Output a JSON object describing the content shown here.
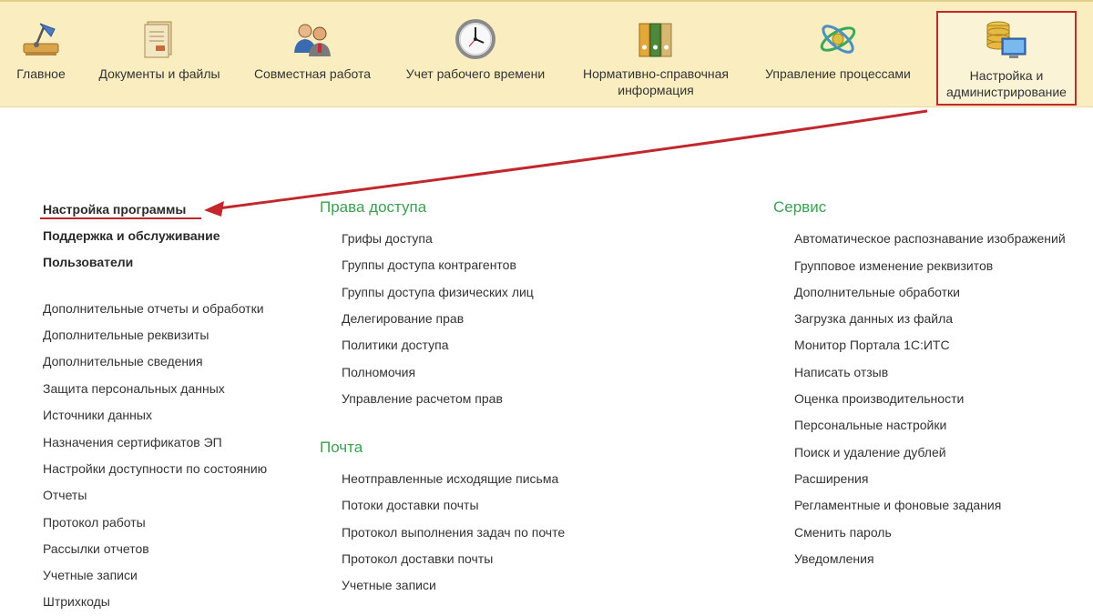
{
  "toolbar": {
    "items": [
      {
        "label": "Главное",
        "icon": "desk-lamp-icon"
      },
      {
        "label": "Документы и файлы",
        "icon": "document-book-icon"
      },
      {
        "label": "Совместная работа",
        "icon": "users-icon"
      },
      {
        "label": "Учет рабочего времени",
        "icon": "clock-icon"
      },
      {
        "label": "Нормативно-справочная\nинформация",
        "icon": "binders-icon"
      },
      {
        "label": "Управление процессами",
        "icon": "process-orbit-icon"
      },
      {
        "label": "Настройка и\nадминистрирование",
        "icon": "database-computer-icon",
        "active": true
      }
    ]
  },
  "left_column": {
    "primary": [
      "Настройка программы",
      "Поддержка и обслуживание",
      "Пользователи"
    ],
    "items": [
      "Дополнительные отчеты и обработки",
      "Дополнительные реквизиты",
      "Дополнительные сведения",
      "Защита персональных данных",
      "Источники данных",
      "Назначения сертификатов ЭП",
      "Настройки доступности по состоянию",
      "Отчеты",
      "Протокол работы",
      "Рассылки отчетов",
      "Учетные записи",
      "Штрихкоды"
    ]
  },
  "access_rights": {
    "title": "Права доступа",
    "items": [
      "Грифы доступа",
      "Группы доступа контрагентов",
      "Группы доступа физических лиц",
      "Делегирование прав",
      "Политики доступа",
      "Полномочия",
      "Управление расчетом прав"
    ]
  },
  "mail": {
    "title": "Почта",
    "items": [
      "Неотправленные исходящие письма",
      "Потоки доставки почты",
      "Протокол выполнения задач по почте",
      "Протокол доставки почты",
      "Учетные записи"
    ]
  },
  "service": {
    "title": "Сервис",
    "items": [
      "Автоматическое распознавание изображений",
      "Групповое изменение реквизитов",
      "Дополнительные обработки",
      "Загрузка данных из файла",
      "Монитор Портала 1С:ИТС",
      "Написать отзыв",
      "Оценка производительности",
      "Персональные настройки",
      "Поиск и удаление дублей",
      "Расширения",
      "Регламентные и фоновые задания",
      "Сменить пароль",
      "Уведомления"
    ]
  },
  "colors": {
    "toolbar_bg": "#faeec0",
    "section_title": "#3d9e52",
    "highlight_red": "#c1272d"
  }
}
